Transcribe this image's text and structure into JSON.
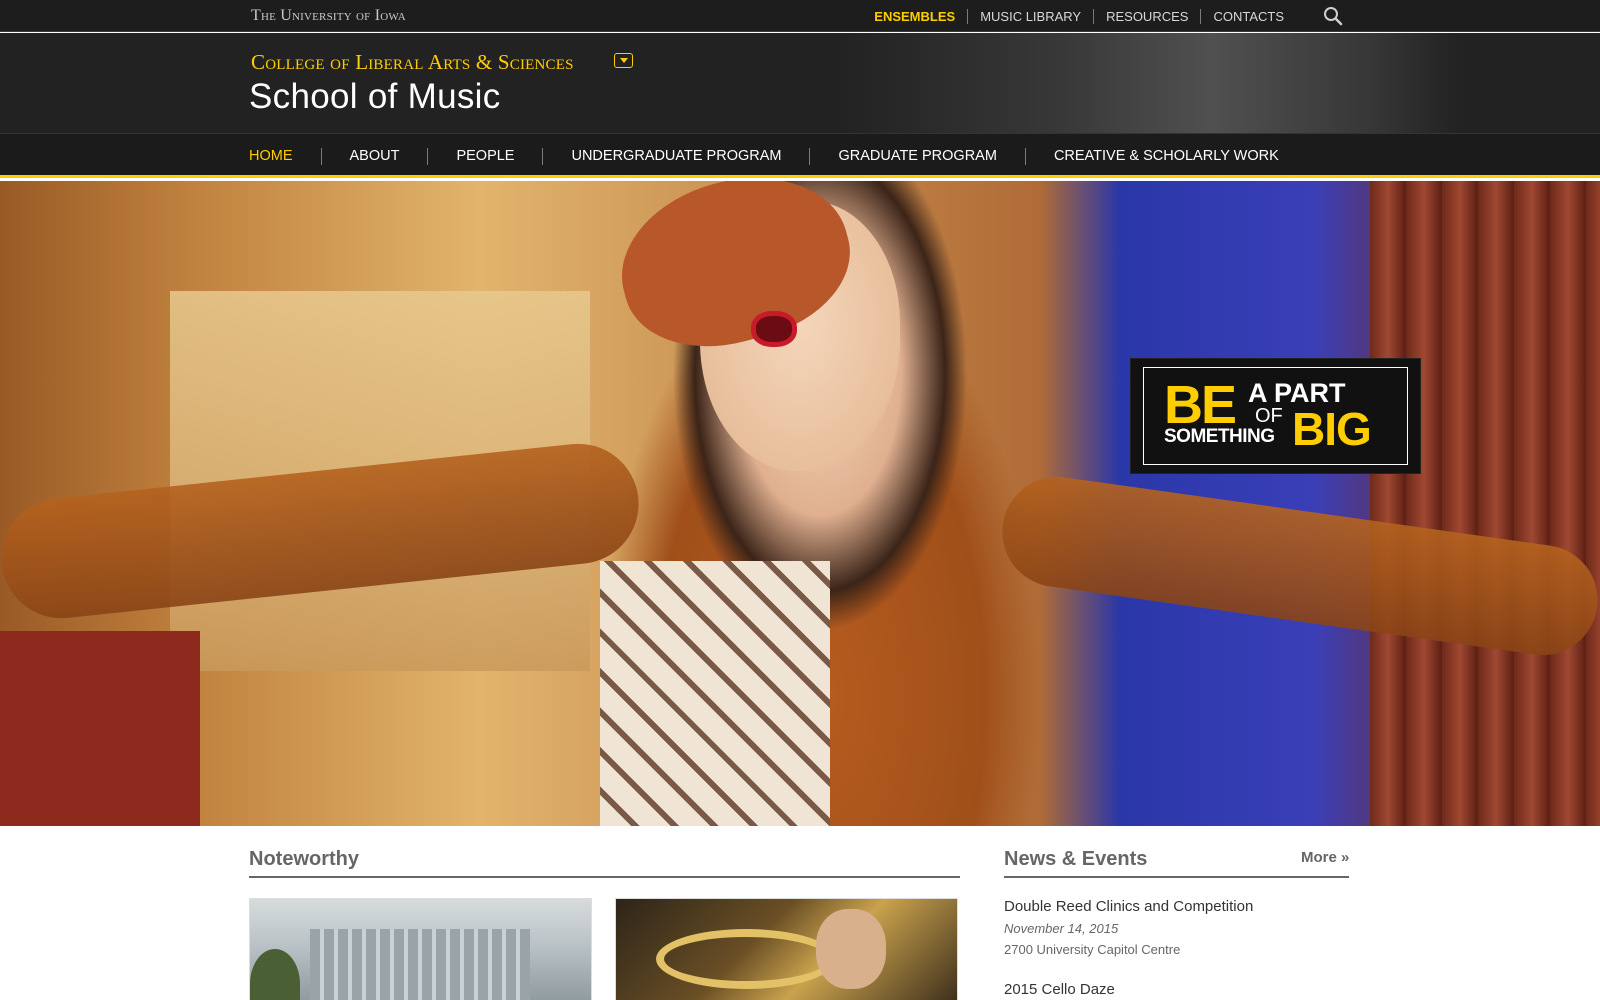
{
  "utility_bar": {
    "university": "The University of Iowa",
    "links": [
      "ENSEMBLES",
      "MUSIC LIBRARY",
      "RESOURCES",
      "CONTACTS"
    ]
  },
  "header": {
    "college": "College of Liberal Arts & Sciences",
    "school": "School of Music"
  },
  "main_nav": {
    "items": [
      "HOME",
      "ABOUT",
      "PEOPLE",
      "UNDERGRADUATE PROGRAM",
      "GRADUATE PROGRAM",
      "CREATIVE & SCHOLARLY WORK"
    ],
    "active": "HOME"
  },
  "promo": {
    "be": "BE",
    "a_part": "A PART",
    "of": "OF",
    "something": "SOMETHING",
    "big": "BIG"
  },
  "noteworthy": {
    "title": "Noteworthy"
  },
  "news": {
    "title": "News & Events",
    "more": "More »",
    "events": [
      {
        "title": "Double Reed Clinics and Competition",
        "date": "November 14, 2015",
        "location": "2700 University Capitol Centre"
      },
      {
        "title": "2015 Cello Daze"
      }
    ]
  },
  "colors": {
    "gold": "#FFCD00",
    "bar": "#1d1d1d"
  },
  "icons": {
    "search": "search-icon",
    "college_toggle": "chevron-down-icon"
  }
}
